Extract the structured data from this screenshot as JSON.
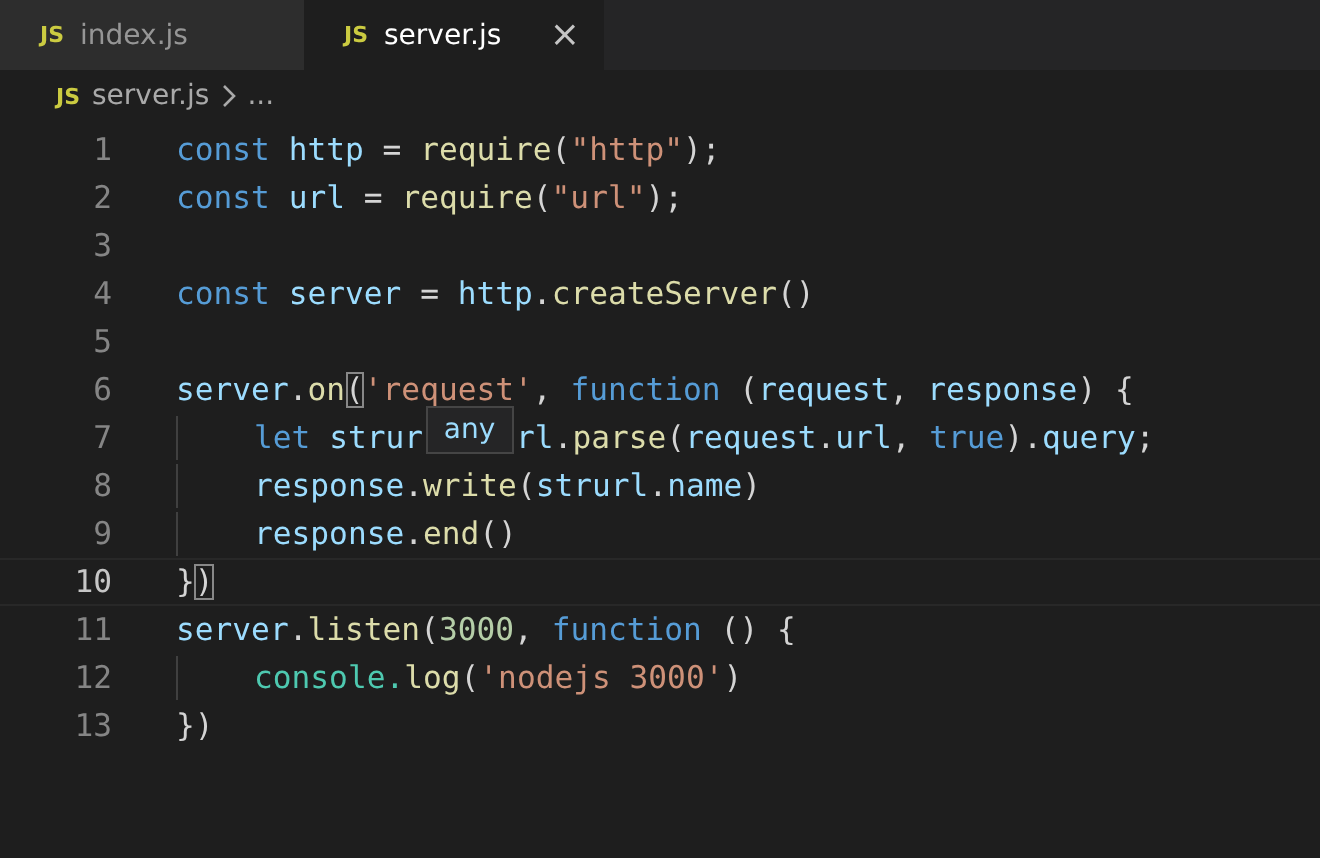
{
  "tabs": [
    {
      "icon_text": "JS",
      "label": "index.js",
      "selected": false
    },
    {
      "icon_text": "JS",
      "label": "server.js",
      "selected": true,
      "close": "×"
    }
  ],
  "breadcrumb": {
    "icon_text": "JS",
    "file": "server.js",
    "rest": "..."
  },
  "lines": [
    {
      "number": "1",
      "current": false,
      "indent": false,
      "tokens": [
        {
          "kind": "keyword",
          "text": "const "
        },
        {
          "kind": "variable",
          "text": "http"
        },
        {
          "kind": "plain",
          "text": " = "
        },
        {
          "kind": "function",
          "text": "require"
        },
        {
          "kind": "plain",
          "text": "("
        },
        {
          "kind": "string",
          "text": "\"http\""
        },
        {
          "kind": "plain",
          "text": ");"
        }
      ]
    },
    {
      "number": "2",
      "current": false,
      "indent": false,
      "tokens": [
        {
          "kind": "keyword",
          "text": "const "
        },
        {
          "kind": "variable",
          "text": "url"
        },
        {
          "kind": "plain",
          "text": " = "
        },
        {
          "kind": "function",
          "text": "require"
        },
        {
          "kind": "plain",
          "text": "("
        },
        {
          "kind": "string",
          "text": "\"url\""
        },
        {
          "kind": "plain",
          "text": ");"
        }
      ]
    },
    {
      "number": "3",
      "current": false,
      "indent": false
    },
    {
      "number": "4",
      "current": false,
      "indent": false,
      "tokens": [
        {
          "kind": "keyword",
          "text": "const "
        },
        {
          "kind": "variable",
          "text": "server"
        },
        {
          "kind": "plain",
          "text": " = "
        },
        {
          "kind": "variable",
          "text": "http"
        },
        {
          "kind": "plain",
          "text": "."
        },
        {
          "kind": "function",
          "text": "createServer"
        },
        {
          "kind": "plain",
          "text": "()"
        }
      ]
    },
    {
      "number": "5",
      "current": false,
      "indent": false
    },
    {
      "number": "6",
      "current": false,
      "indent": false,
      "tokens": [
        {
          "kind": "variable",
          "text": "server"
        },
        {
          "kind": "plain",
          "text": "."
        },
        {
          "kind": "function",
          "text": "on"
        },
        {
          "kind": "match",
          "text": "("
        },
        {
          "kind": "string",
          "text": "'request'"
        },
        {
          "kind": "plain",
          "text": ", "
        },
        {
          "kind": "keyword",
          "text": "function"
        },
        {
          "kind": "plain",
          "text": " ("
        },
        {
          "kind": "variable",
          "text": "request"
        },
        {
          "kind": "plain",
          "text": ", "
        },
        {
          "kind": "variable",
          "text": "response"
        },
        {
          "kind": "plain",
          "text": ") {"
        }
      ]
    },
    {
      "number": "7",
      "current": false,
      "indent": true,
      "tokens": [
        {
          "kind": "keyword",
          "text": "let "
        },
        {
          "kind": "variable",
          "text": "strur"
        },
        {
          "kind": "tooltip",
          "text": "any"
        },
        {
          "kind": "variable",
          "text": "rl"
        },
        {
          "kind": "plain",
          "text": "."
        },
        {
          "kind": "function",
          "text": "parse"
        },
        {
          "kind": "plain",
          "text": "("
        },
        {
          "kind": "variable",
          "text": "request"
        },
        {
          "kind": "plain",
          "text": "."
        },
        {
          "kind": "variable",
          "text": "url"
        },
        {
          "kind": "plain",
          "text": ", "
        },
        {
          "kind": "keyword",
          "text": "true"
        },
        {
          "kind": "plain",
          "text": ")."
        },
        {
          "kind": "variable",
          "text": "query"
        },
        {
          "kind": "plain",
          "text": ";"
        }
      ]
    },
    {
      "number": "8",
      "current": false,
      "indent": true,
      "tokens": [
        {
          "kind": "variable",
          "text": "response"
        },
        {
          "kind": "plain",
          "text": "."
        },
        {
          "kind": "function",
          "text": "write"
        },
        {
          "kind": "plain",
          "text": "("
        },
        {
          "kind": "variable",
          "text": "strurl"
        },
        {
          "kind": "plain",
          "text": "."
        },
        {
          "kind": "variable",
          "text": "name"
        },
        {
          "kind": "plain",
          "text": ")"
        }
      ]
    },
    {
      "number": "9",
      "current": false,
      "indent": true,
      "tokens": [
        {
          "kind": "variable",
          "text": "response"
        },
        {
          "kind": "plain",
          "text": "."
        },
        {
          "kind": "function",
          "text": "end"
        },
        {
          "kind": "plain",
          "text": "()"
        }
      ]
    },
    {
      "number": "10",
      "current": true,
      "indent": false,
      "tokens": [
        {
          "kind": "plain",
          "text": "}"
        },
        {
          "kind": "match",
          "text": ")"
        }
      ]
    },
    {
      "number": "11",
      "current": false,
      "indent": false,
      "tokens": [
        {
          "kind": "variable",
          "text": "server"
        },
        {
          "kind": "plain",
          "text": "."
        },
        {
          "kind": "function",
          "text": "listen"
        },
        {
          "kind": "plain",
          "text": "("
        },
        {
          "kind": "number",
          "text": "3000"
        },
        {
          "kind": "plain",
          "text": ", "
        },
        {
          "kind": "keyword",
          "text": "function"
        },
        {
          "kind": "plain",
          "text": " () {"
        }
      ]
    },
    {
      "number": "12",
      "current": false,
      "indent": true,
      "tokens": [
        {
          "kind": "class",
          "text": "console."
        },
        {
          "kind": "function",
          "text": "log"
        },
        {
          "kind": "plain",
          "text": "("
        },
        {
          "kind": "string",
          "text": "'nodejs 3000'"
        },
        {
          "kind": "plain",
          "text": ")"
        }
      ]
    },
    {
      "number": "13",
      "current": false,
      "indent": false,
      "tokens": [
        {
          "kind": "plain",
          "text": "})"
        }
      ]
    }
  ]
}
